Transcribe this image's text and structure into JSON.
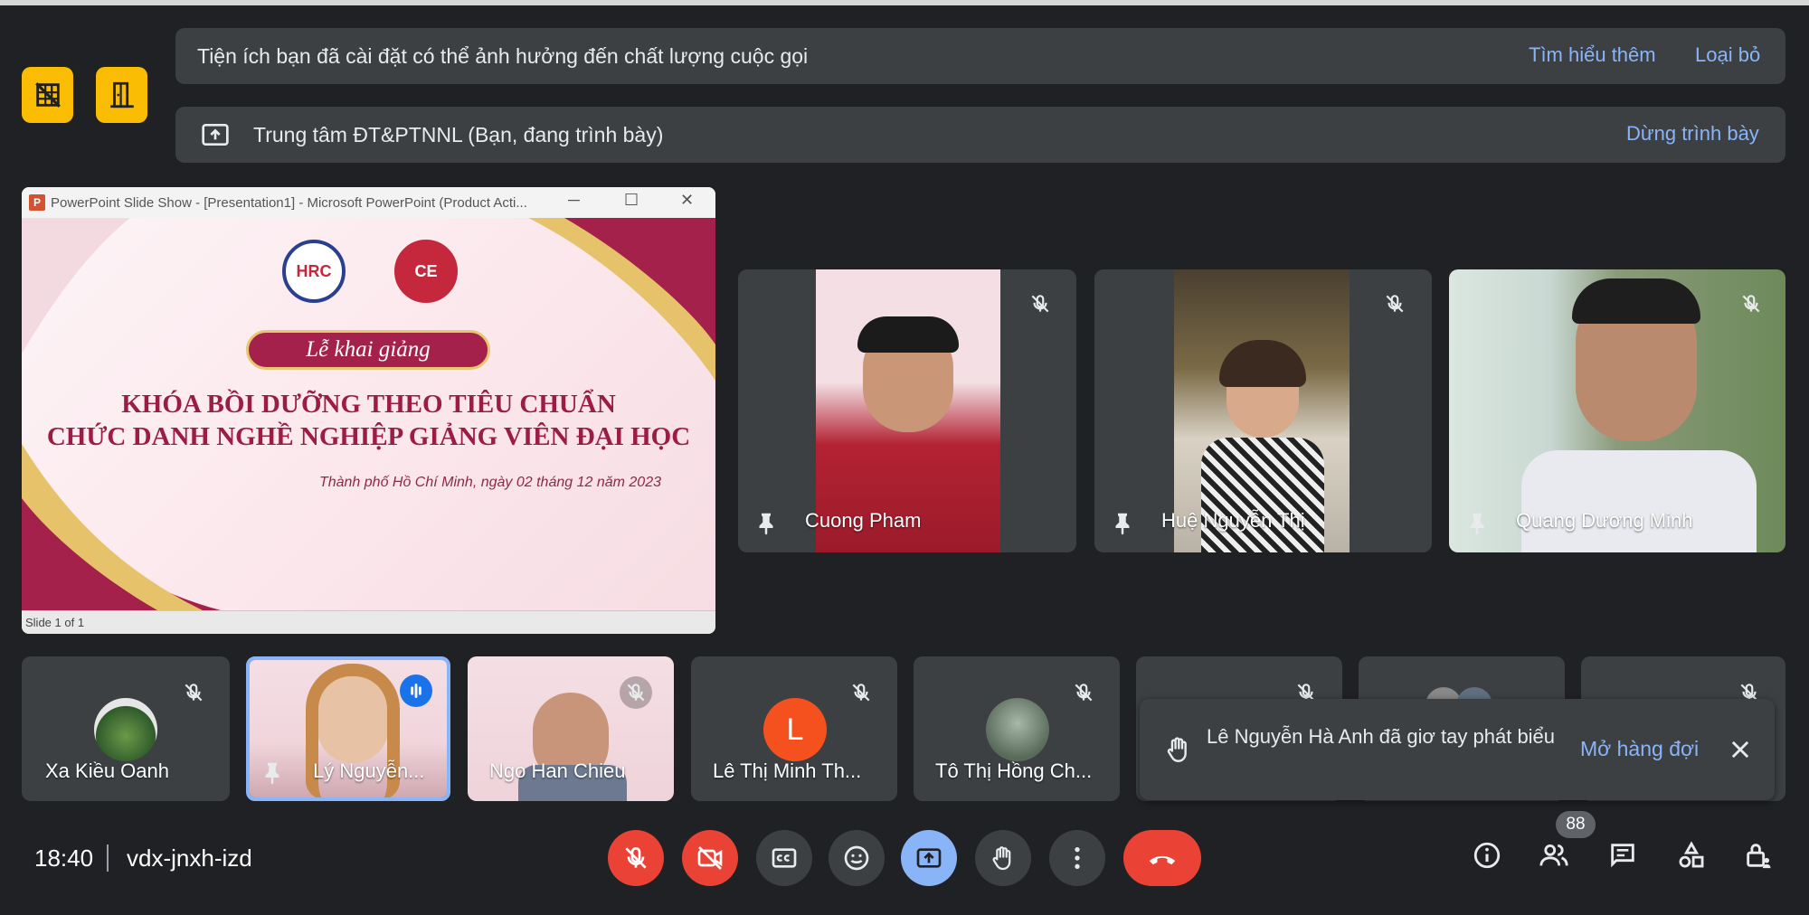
{
  "top_actions": {
    "left_icon": "grid-off-icon",
    "right_icon": "door-icon"
  },
  "banner_addon": {
    "text": "Tiện ích bạn đã cài đặt có thể ảnh hưởng đến chất lượng cuộc gọi",
    "learn_more": "Tìm hiểu thêm",
    "dismiss": "Loại bỏ"
  },
  "banner_presenting": {
    "text": "Trung tâm ĐT&PTNNL (Bạn, đang trình bày)",
    "stop": "Dừng trình bày"
  },
  "presentation": {
    "window_title": "PowerPoint Slide Show - [Presentation1] - Microsoft PowerPoint (Product Acti...",
    "app_glyph": "P",
    "seal_left": "HRC",
    "seal_right": "CE",
    "ribbon": "Lễ khai giảng",
    "title_line1": "KHÓA BỒI DƯỠNG THEO TIÊU CHUẨN",
    "title_line2": "CHỨC DANH NGHỀ NGHIỆP GIẢNG VIÊN ĐẠI HỌC",
    "date": "Thành phố Hồ Chí Minh, ngày 02 tháng 12 năm 2023",
    "status": "Slide 1 of 1"
  },
  "large_tiles": [
    {
      "name": "Cuong Pham"
    },
    {
      "name": "Huệ Nguyễn Thị"
    },
    {
      "name": "Quang Dương Minh"
    }
  ],
  "small_tiles": [
    {
      "name": "Xa Kiều Oanh"
    },
    {
      "name": "Lý Nguyễn..."
    },
    {
      "name": "Ngo Han Chieu"
    },
    {
      "name": "Lê Thị Minh Th...",
      "initial": "L"
    },
    {
      "name": "Tô Thị Hồng Ch..."
    }
  ],
  "notification": {
    "text": "Lê Nguyễn Hà Anh đã giơ tay phát biểu",
    "action": "Mở hàng đợi"
  },
  "bottom_bar": {
    "time": "18:40",
    "meeting_code": "vdx-jnxh-izd",
    "participant_count": "88"
  },
  "colors": {
    "background": "#202124",
    "surface": "#3c4043",
    "link": "#8ab4f8",
    "danger": "#ea4335",
    "warning": "#fbbc04"
  }
}
